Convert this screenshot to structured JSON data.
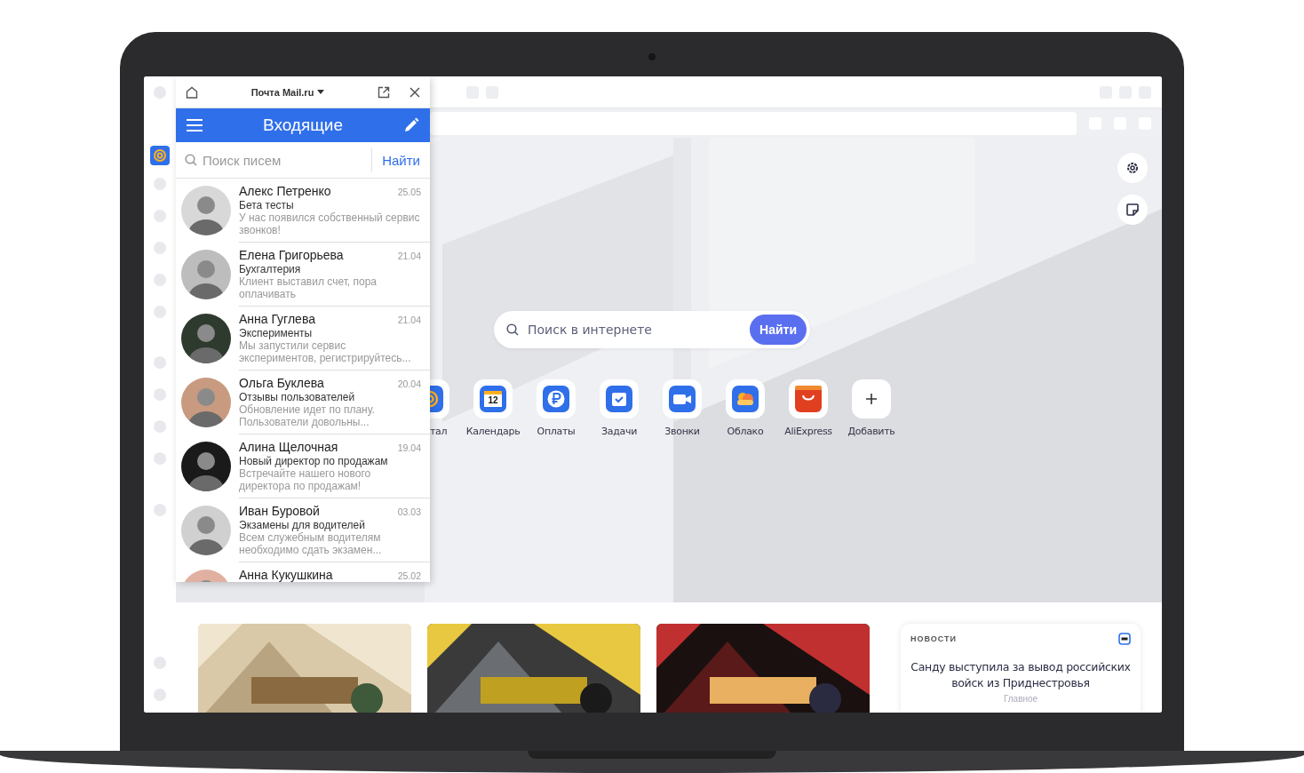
{
  "mail_panel": {
    "title": "Почта Mail.ru",
    "folder": "Входящие",
    "search": {
      "placeholder": "Поиск писем",
      "button": "Найти"
    },
    "messages": [
      {
        "name": "Алекс Петренко",
        "date": "25.05",
        "subject": "Бета тесты",
        "preview": "У нас появился собственный сервис звонков!"
      },
      {
        "name": "Елена Григорьева",
        "date": "21.04",
        "subject": "Бухгалтерия",
        "preview": "Клиент выставил счет, пора оплачивать"
      },
      {
        "name": "Анна Гуглева",
        "date": "21.04",
        "subject": "Эксперименты",
        "preview": "Мы запустили сервис экспериментов, регистрируйтесь..."
      },
      {
        "name": "Ольга Буклева",
        "date": "20.04",
        "subject": "Отзывы пользователей",
        "preview": "Обновление идет по плану. Пользователи довольны..."
      },
      {
        "name": "Алина Щелочная",
        "date": "19.04",
        "subject": "Новый директор по продажам",
        "preview": "Встречайте нашего нового директора по продажам!"
      },
      {
        "name": "Иван Буровой",
        "date": "03.03",
        "subject": "Экзамены для водителей",
        "preview": "Всем служебным водителям необходимо сдать экзамен..."
      },
      {
        "name": "Анна Кукушкина",
        "date": "25.02"
      }
    ]
  },
  "web_search": {
    "placeholder": "Поиск в интернете",
    "button": "Найти"
  },
  "shortcuts": [
    {
      "kind": "mail",
      "label": "тал"
    },
    {
      "kind": "calendar",
      "label": "Календарь",
      "badge": "12"
    },
    {
      "kind": "payments",
      "label": "Оплаты"
    },
    {
      "kind": "tasks",
      "label": "Задачи"
    },
    {
      "kind": "calls",
      "label": "Звонки"
    },
    {
      "kind": "cloud",
      "label": "Облако"
    },
    {
      "kind": "shop",
      "label": "AliExpress"
    },
    {
      "kind": "add",
      "label": "Добавить"
    }
  ],
  "news": {
    "heading": "НОВОСТИ",
    "headline": "Санду выступила за вывод российских войск из Приднестровья",
    "source": "Главное"
  }
}
